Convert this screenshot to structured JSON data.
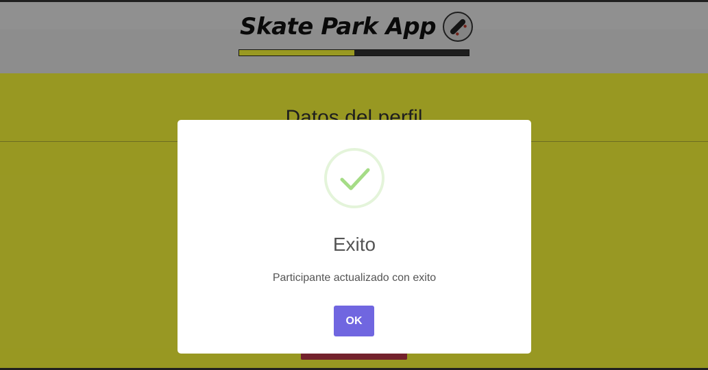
{
  "app": {
    "title": "Skate Park App",
    "logo_icon": "skateboard-icon",
    "progress_fraction": 0.5
  },
  "page": {
    "section_title": "Datos del perfil"
  },
  "modal": {
    "icon": "success-check-icon",
    "title": "Exito",
    "message": "Participante actualizado con exito",
    "ok_label": "OK"
  },
  "colors": {
    "page_background": "#fefe3a",
    "accent_button": "#7066e0",
    "success_green": "#a5dc86",
    "danger_button": "#c03a4a"
  }
}
